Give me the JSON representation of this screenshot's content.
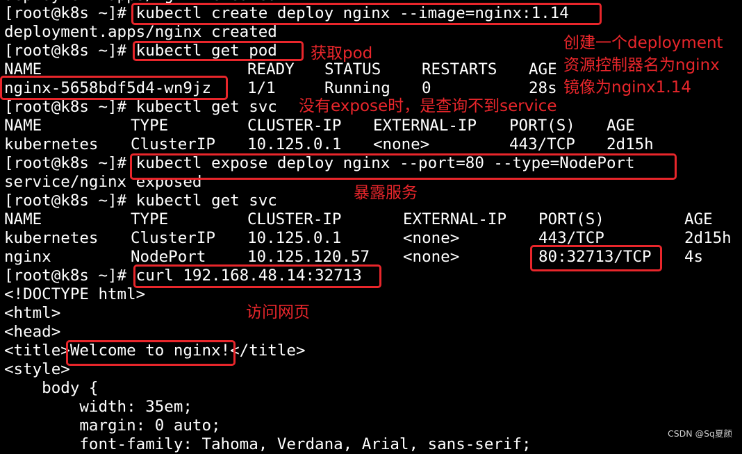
{
  "terminal": {
    "prompt": "[root@k8s ~]# ",
    "cmd_create": "kubectl create deploy nginx --image=nginx:1.14",
    "out_created": "deployment.apps/nginx created",
    "cmd_get_pod": "kubectl get pod",
    "pod_table": {
      "headers": [
        "NAME",
        "READY",
        "STATUS",
        "RESTARTS",
        "AGE"
      ],
      "rows": [
        [
          "nginx-5658bdf5d4-wn9jz",
          "1/1",
          "Running",
          "0",
          "28s"
        ]
      ]
    },
    "cmd_get_svc": "kubectl get svc",
    "svc_table_1": {
      "headers": [
        "NAME",
        "TYPE",
        "CLUSTER-IP",
        "EXTERNAL-IP",
        "PORT(S)",
        "AGE"
      ],
      "rows": [
        [
          "kubernetes",
          "ClusterIP",
          "10.125.0.1",
          "<none>",
          "443/TCP",
          "2d15h"
        ]
      ]
    },
    "cmd_expose": "kubectl expose deploy nginx --port=80 --type=NodePort",
    "out_exposed": "service/nginx exposed",
    "svc_table_2": {
      "headers": [
        "NAME",
        "TYPE",
        "CLUSTER-IP",
        "EXTERNAL-IP",
        "PORT(S)",
        "AGE"
      ],
      "rows": [
        [
          "kubernetes",
          "ClusterIP",
          "10.125.0.1",
          "<none>",
          "443/TCP",
          "2d15h"
        ],
        [
          "nginx",
          "NodePort",
          "10.125.120.57",
          "<none>",
          "80:32713/TCP",
          "4s"
        ]
      ]
    },
    "cmd_curl": "curl 192.168.48.14:32713",
    "html_output": {
      "doctype": "<!DOCTYPE html>",
      "html_open": "<html>",
      "head_open": "<head>",
      "title_open": "<title>",
      "title_text": "Welcome to nginx!",
      "title_close": "</title>",
      "style_open": "<style>",
      "body_rule": "    body {",
      "width_rule": "        width: 35em;",
      "margin_rule": "        margin: 0 auto;",
      "font_rule": "        font-family: Tahoma, Verdana, Arial, sans-serif;"
    }
  },
  "annotations": {
    "create_deploy": [
      "创建一个deployment",
      "资源控制器名为nginx",
      "镜像为nginx1.14"
    ],
    "get_pod": "获取pod",
    "no_expose": "没有expose时，是查询不到service",
    "expose": "暴露服务",
    "visit": "访问网页"
  },
  "watermark": "CSDN @Sq夏颜",
  "colors": {
    "background": "#000000",
    "text": "#ffffff",
    "annotation": "#e8262b"
  }
}
